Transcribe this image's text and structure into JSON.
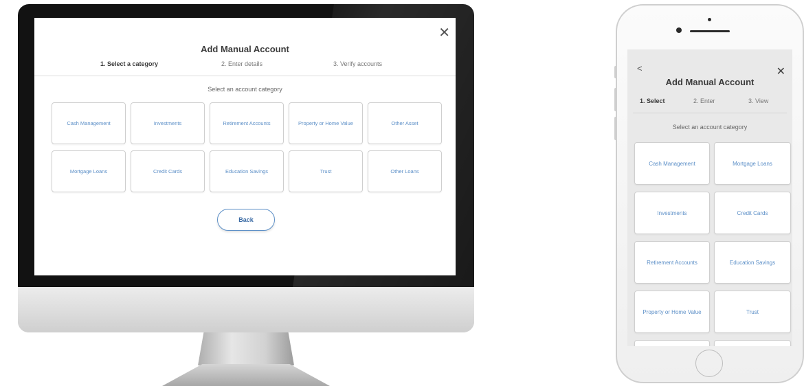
{
  "desktop": {
    "close_symbol": "✕",
    "title": "Add Manual Account",
    "steps": [
      "1. Select a category",
      "2. Enter details",
      "3. Verify accounts"
    ],
    "subtitle": "Select an account category",
    "categories": [
      "Cash Management",
      "Investments",
      "Retirement Accounts",
      "Property or Home Value",
      "Other Asset",
      "Mortgage Loans",
      "Credit Cards",
      "Education Savings",
      "Trust",
      "Other Loans"
    ],
    "back_label": "Back"
  },
  "mobile": {
    "back_symbol": "<",
    "close_symbol": "✕",
    "title": "Add Manual Account",
    "steps": [
      "1. Select",
      "2. Enter",
      "3. View"
    ],
    "subtitle": "Select an account category",
    "categories": [
      "Cash Management",
      "Mortgage Loans",
      "Investments",
      "Credit Cards",
      "Retirement Accounts",
      "Education Savings",
      "Property or Home Value",
      "Trust",
      "",
      ""
    ]
  },
  "colors": {
    "accent": "#5c8fc7",
    "tile_border": "#cfcfcf",
    "bezel": "#121212"
  }
}
